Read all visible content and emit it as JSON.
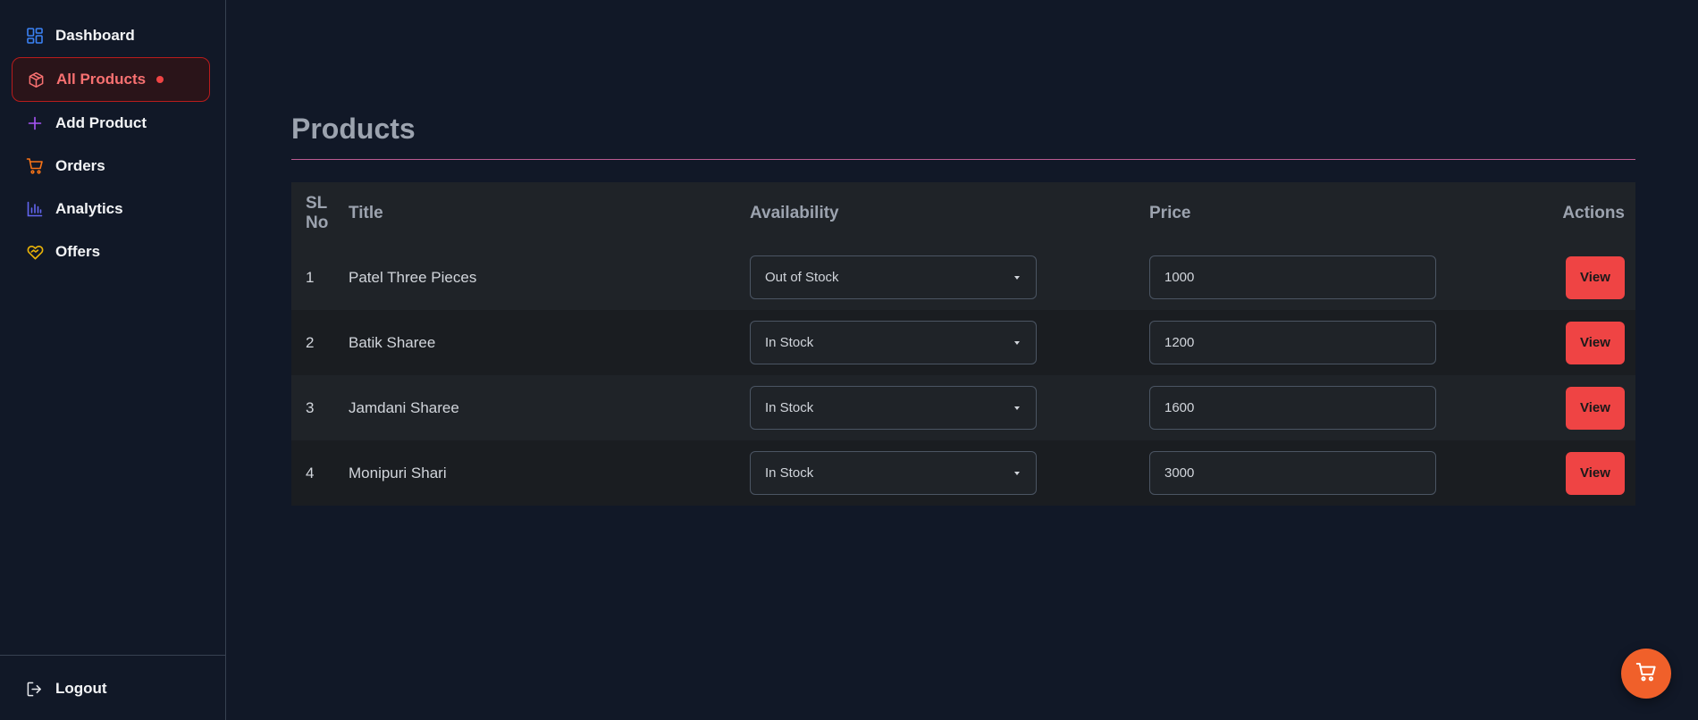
{
  "colors": {
    "background": "#111827",
    "accent": "#ef4444",
    "fab": "#f0602a",
    "title_rule": "#f472b6"
  },
  "sidebar": {
    "items": [
      {
        "label": "Dashboard",
        "icon": "dashboard-icon",
        "active": false
      },
      {
        "label": "All Products",
        "icon": "box-icon",
        "active": true
      },
      {
        "label": "Add Product",
        "icon": "plus-icon",
        "active": false
      },
      {
        "label": "Orders",
        "icon": "cart-icon",
        "active": false
      },
      {
        "label": "Analytics",
        "icon": "bar-chart-icon",
        "active": false
      },
      {
        "label": "Offers",
        "icon": "heart-tag-icon",
        "active": false
      }
    ],
    "logout_label": "Logout"
  },
  "main": {
    "title": "Products",
    "table": {
      "headers": {
        "sl": "SL No",
        "title": "Title",
        "availability": "Availability",
        "price": "Price",
        "actions": "Actions"
      },
      "rows": [
        {
          "sl": "1",
          "title": "Patel Three Pieces",
          "availability": "Out of Stock",
          "price": "1000",
          "action": "View"
        },
        {
          "sl": "2",
          "title": "Batik Sharee",
          "availability": "In Stock",
          "price": "1200",
          "action": "View"
        },
        {
          "sl": "3",
          "title": "Jamdani Sharee",
          "availability": "In Stock",
          "price": "1600",
          "action": "View"
        },
        {
          "sl": "4",
          "title": "Monipuri Shari",
          "availability": "In Stock",
          "price": "3000",
          "action": "View"
        }
      ]
    }
  },
  "fab": {
    "icon": "cart-icon"
  }
}
